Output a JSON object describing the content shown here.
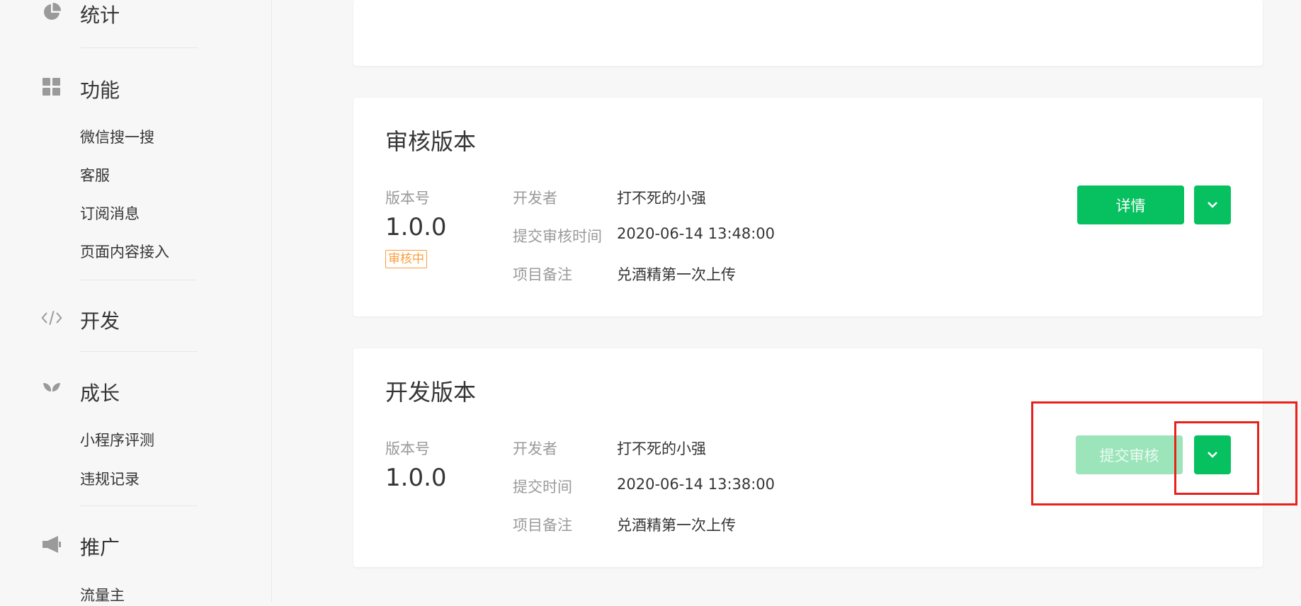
{
  "sidebar": {
    "stats": {
      "label": "统计",
      "icon": "pie-chart-icon"
    },
    "features": {
      "label": "功能",
      "icon": "grid-icon",
      "items": [
        "微信搜一搜",
        "客服",
        "订阅消息",
        "页面内容接入"
      ]
    },
    "develop": {
      "label": "开发",
      "icon": "code-icon"
    },
    "growth": {
      "label": "成长",
      "icon": "sprout-icon",
      "items": [
        "小程序评测",
        "违规记录"
      ]
    },
    "promote": {
      "label": "推广",
      "icon": "megaphone-icon",
      "items": [
        "流量主"
      ]
    }
  },
  "review_card": {
    "title": "审核版本",
    "version_label": "版本号",
    "version": "1.0.0",
    "status_badge": "审核中",
    "developer_key": "开发者",
    "developer_val": "打不死的小强",
    "time_key": "提交审核时间",
    "time_val": "2020-06-14 13:48:00",
    "note_key": "项目备注",
    "note_val": "兑酒精第一次上传",
    "detail_button": "详情"
  },
  "dev_card": {
    "title": "开发版本",
    "version_label": "版本号",
    "version": "1.0.0",
    "developer_key": "开发者",
    "developer_val": "打不死的小强",
    "time_key": "提交时间",
    "time_val": "2020-06-14 13:38:00",
    "note_key": "项目备注",
    "note_val": "兑酒精第一次上传",
    "submit_button": "提交审核"
  },
  "colors": {
    "primary": "#07c160",
    "primary_disabled": "#9ce5bb",
    "badge": "#fa9d3b",
    "highlight": "#e8221b"
  }
}
